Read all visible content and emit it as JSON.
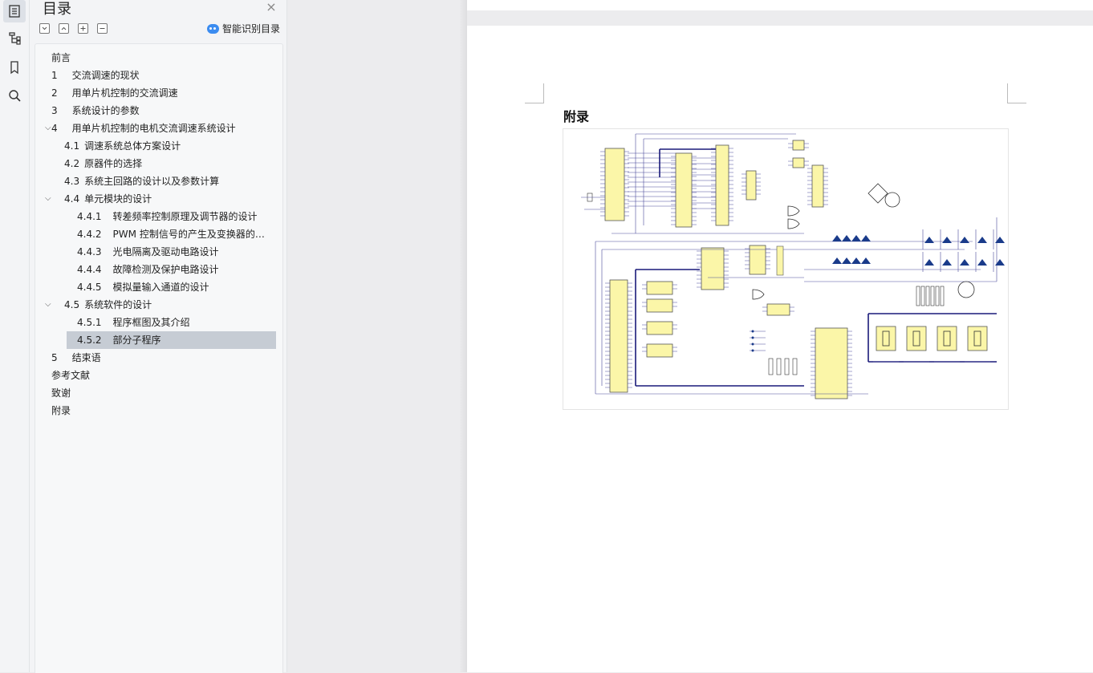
{
  "toc": {
    "title": "目录",
    "smart_label": "智能识别目录",
    "items": [
      {
        "num": "",
        "label": "前言",
        "level": 0,
        "chevron": false,
        "selected": false
      },
      {
        "num": "1",
        "label": "交流调速的现状",
        "level": 0,
        "chevron": false,
        "selected": false
      },
      {
        "num": "2",
        "label": "用单片机控制的交流调速",
        "level": 0,
        "chevron": false,
        "selected": false
      },
      {
        "num": "3",
        "label": "系统设计的参数",
        "level": 0,
        "chevron": false,
        "selected": false
      },
      {
        "num": "4",
        "label": "用单片机控制的电机交流调速系统设计",
        "level": 0,
        "chevron": true,
        "selected": false
      },
      {
        "num": "4.1",
        "label": "调速系统总体方案设计",
        "level": 1,
        "chevron": false,
        "selected": false
      },
      {
        "num": "4.2",
        "label": "原器件的选择",
        "level": 1,
        "chevron": false,
        "selected": false
      },
      {
        "num": "4.3",
        "label": "系统主回路的设计以及参数计算",
        "level": 1,
        "chevron": false,
        "selected": false
      },
      {
        "num": "4.4",
        "label": "单元模块的设计",
        "level": 1,
        "chevron": true,
        "selected": false
      },
      {
        "num": "4.4.1",
        "label": "转差频率控制原理及调节器的设计",
        "level": 2,
        "chevron": false,
        "selected": false
      },
      {
        "num": "4.4.2",
        "label": "PWM 控制信号的产生及变换器的设计",
        "level": 2,
        "chevron": false,
        "selected": false
      },
      {
        "num": "4.4.3",
        "label": "光电隔离及驱动电路设计",
        "level": 2,
        "chevron": false,
        "selected": false
      },
      {
        "num": "4.4.4",
        "label": "故障检测及保护电路设计",
        "level": 2,
        "chevron": false,
        "selected": false
      },
      {
        "num": "4.4.5",
        "label": "模拟量输入通道的设计",
        "level": 2,
        "chevron": false,
        "selected": false
      },
      {
        "num": "4.5",
        "label": "系统软件的设计",
        "level": 1,
        "chevron": true,
        "selected": false
      },
      {
        "num": "4.5.1",
        "label": "程序框图及其介绍",
        "level": 2,
        "chevron": false,
        "selected": false
      },
      {
        "num": "4.5.2",
        "label": "部分子程序",
        "level": 2,
        "chevron": false,
        "selected": true
      },
      {
        "num": "5",
        "label": "结束语",
        "level": 0,
        "chevron": false,
        "selected": false
      },
      {
        "num": "",
        "label": "参考文献",
        "level": 0,
        "chevron": false,
        "selected": false
      },
      {
        "num": "",
        "label": "致谢",
        "level": 0,
        "chevron": false,
        "selected": false
      },
      {
        "num": "",
        "label": "附录",
        "level": 0,
        "chevron": false,
        "selected": false
      }
    ]
  },
  "rail": {
    "icons": [
      "toc-icon",
      "structure-icon",
      "bookmark-icon",
      "search-icon"
    ]
  },
  "document": {
    "heading": "附录"
  },
  "colors": {
    "accent": "#3b8cf0",
    "selected_bg": "#c6ccd4",
    "wire": "#4a4a9a",
    "chip_fill": "#fbf6a8"
  }
}
